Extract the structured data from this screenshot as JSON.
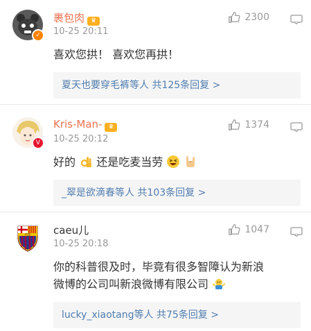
{
  "comments": [
    {
      "user": "裹包肉",
      "time": "10-25 20:11",
      "likes": "2300",
      "text": "喜欢您拱！ 喜欢您再拱！",
      "reply_users": "夏天也要穿毛裤等人",
      "reply_count": "共125条回复 >",
      "avatar_icon": "panda-avatar-icon"
    },
    {
      "user": "Kris-Man-",
      "time": "10-25 20:12",
      "likes": "1374",
      "text_a": "好的",
      "text_b": " 还是吃麦当劳",
      "reply_users": "_翠是欲滴春等人",
      "reply_count": "共103条回复 >",
      "avatar_icon": "anime-avatar-icon"
    },
    {
      "user": "caeu儿",
      "time": "10-25 20:18",
      "likes": "1047",
      "text_l1": "你的科普很及时，毕竟有很多智障认为新浪",
      "text_l2": "微博的公司叫新浪微博有限公司",
      "reply_users": "lucky_xiaotang等人",
      "reply_count": "共75条回复 >",
      "avatar_icon": "fc-barcelona-crest-icon"
    }
  ],
  "colors": {
    "username": "#eb7350",
    "reply_link": "#507daf",
    "reply_bg": "#f5f5f5",
    "meta": "#999999"
  }
}
